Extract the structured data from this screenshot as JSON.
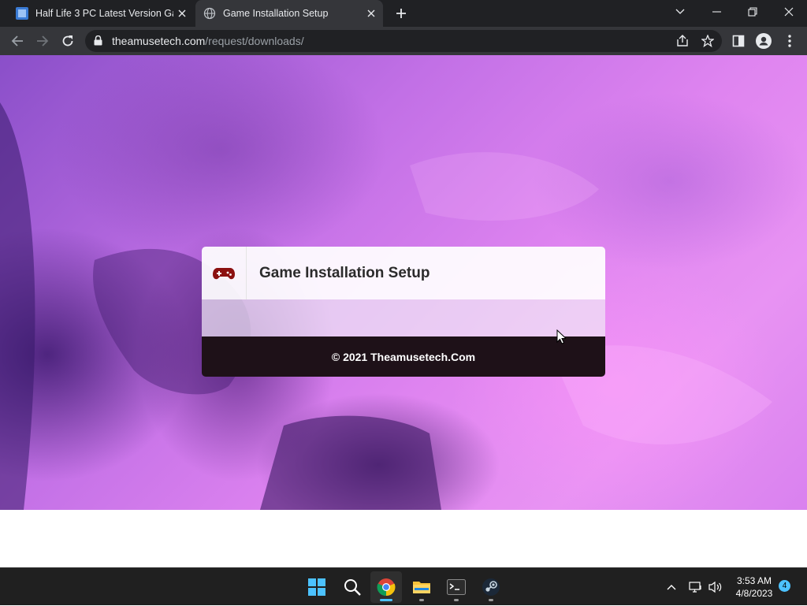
{
  "browser": {
    "tabs": [
      {
        "title": "Half Life 3 PC Latest Version Game",
        "active": false
      },
      {
        "title": "Game Installation Setup",
        "active": true
      }
    ],
    "url": {
      "host": "theamusetech.com",
      "path": "/request/downloads/"
    }
  },
  "page": {
    "card": {
      "title": "Game Installation Setup",
      "footer": "© 2021 Theamusetech.Com"
    }
  },
  "taskbar": {
    "apps": [
      "start",
      "search",
      "chrome",
      "file-explorer",
      "terminal",
      "steam"
    ],
    "clock": {
      "time": "3:53 AM",
      "date": "4/8/2023"
    },
    "notification_count": "4"
  },
  "colors": {
    "chrome_dark": "#202124",
    "chrome_toolbar": "#35363a",
    "gamepad_icon": "#8b1010",
    "card_footer": "#1e1118",
    "taskbar": "#202020"
  }
}
